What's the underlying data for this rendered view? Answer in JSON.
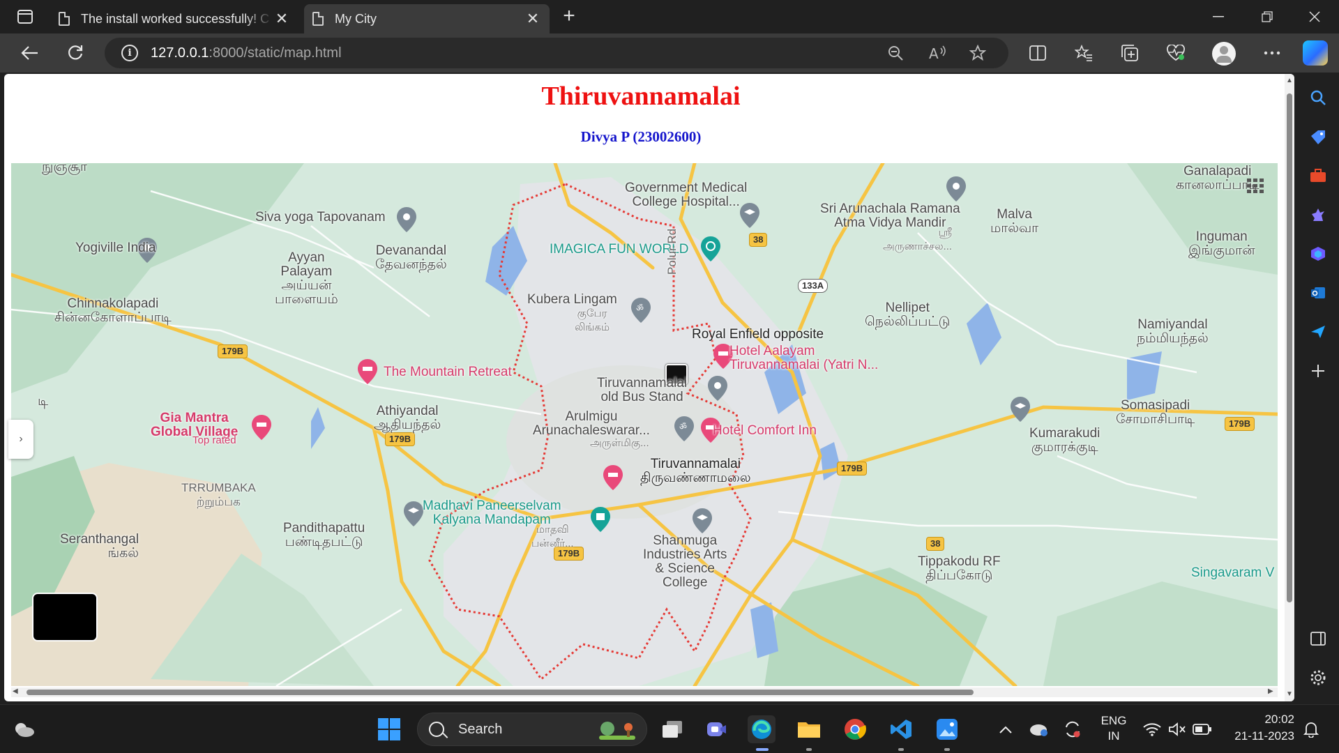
{
  "browser": {
    "tabs": [
      {
        "title": "The install worked successfully! C",
        "active": false
      },
      {
        "title": "My City",
        "active": true
      }
    ],
    "new_tab_symbol": "+",
    "close_symbol": "✕",
    "url_host": "127.0.0.1",
    "url_path": ":8000/static/map.html",
    "info_symbol": "i"
  },
  "page": {
    "title": "Thiruvannamalai",
    "subtitle": "Divya P (23002600)"
  },
  "map": {
    "labels": [
      {
        "id": "nunjur",
        "text": "நுஞ்சூர்"
      },
      {
        "id": "govt-med",
        "text": "Government Medical\nCollege Hospital..."
      },
      {
        "id": "sri-arunachala",
        "text": "Sri Arunachala Ramana\nAtma Vidya Mandir"
      },
      {
        "id": "sri-arunachala-ta",
        "text": "ஸ்ரீ\nஅருணாச்சல..."
      },
      {
        "id": "malva",
        "text": "Malva\nமால்வா"
      },
      {
        "id": "ganalapadi",
        "text": "Ganalapadi\nகானலாப்பாடி"
      },
      {
        "id": "siva-yoga",
        "text": "Siva yoga Tapovanam"
      },
      {
        "id": "yogiville",
        "text": "Yogiville India"
      },
      {
        "id": "ayyan",
        "text": "Ayyan\nPalayam\nஅய்யன்\nபாளையம்"
      },
      {
        "id": "devanandal",
        "text": "Devanandal\nதேவனந்தல்"
      },
      {
        "id": "imagica",
        "text": "IMAGICA FUN WORLD"
      },
      {
        "id": "inguman",
        "text": "Inguman\nஇங்குமான்"
      },
      {
        "id": "chinnakolapadi",
        "text": "Chinnakolapadi\nசின்னகோளாப்பாடி"
      },
      {
        "id": "kubera",
        "text": "Kubera Lingam"
      },
      {
        "id": "kubera-ta",
        "text": "குபேர\nலிங்கம்"
      },
      {
        "id": "polur",
        "text": "Polur Rd"
      },
      {
        "id": "nellipet",
        "text": "Nellipet\nநெல்லிப்பட்டு"
      },
      {
        "id": "namiyandal",
        "text": "Namiyandal\nநம்மியந்தல்"
      },
      {
        "id": "royal-enfield",
        "text": "Royal Enfield opposite"
      },
      {
        "id": "hotel-aalayam",
        "text": "Hotel Aalayam\nTiruvannamalai (Yatri N..."
      },
      {
        "id": "mountain-retreat",
        "text": "The Mountain Retreat"
      },
      {
        "id": "old-bus-stand",
        "text": "Tiruvannamalai\nold Bus Stand"
      },
      {
        "id": "somasipadi",
        "text": "Somasipadi\nசோமாசிபாடி"
      },
      {
        "id": "gia-mantra",
        "text": "Gia Mantra\nGlobal Village"
      },
      {
        "id": "top-rated",
        "text": "Top rated"
      },
      {
        "id": "athiyandal",
        "text": "Athiyandal\nஆதியந்தல்"
      },
      {
        "id": "arulmigu",
        "text": "Arulmigu\nArunachaleswarar..."
      },
      {
        "id": "arulmigu-ta",
        "text": "அருள்மிகு..."
      },
      {
        "id": "hotel-comfort",
        "text": "Hotel Comfort Inn"
      },
      {
        "id": "kumarakudi",
        "text": "Kumarakudi\nகுமாரக்குடி"
      },
      {
        "id": "tiruvannamalai",
        "text": "Tiruvannamalai\nதிருவண்ணாமலை"
      },
      {
        "id": "trrumbaka",
        "text": "TRRUMBAKA\nற்றும்பக"
      },
      {
        "id": "madhavi",
        "text": "Madhavi Paneerselvam\nKalyana Mandapam"
      },
      {
        "id": "madhavi-ta",
        "text": "மாதவி\nபன்னீர்..."
      },
      {
        "id": "pandithapattu",
        "text": "Pandithapattu\nபண்டிதபட்டு"
      },
      {
        "id": "seranthangal",
        "text": "Seranthangal\nங்கல்"
      },
      {
        "id": "shanmuga",
        "text": "Shanmuga\nIndustries Arts\n& Science\nCollege"
      },
      {
        "id": "tippakodu",
        "text": "Tippakodu RF\nதிப்பகோடு"
      },
      {
        "id": "singavaram",
        "text": "Singavaram V"
      },
      {
        "id": "edge-di",
        "text": "டி"
      }
    ],
    "shields": [
      {
        "id": "s38a",
        "text": "38"
      },
      {
        "id": "s133a",
        "text": "133A"
      },
      {
        "id": "s179b-1",
        "text": "179B"
      },
      {
        "id": "s179b-2",
        "text": "179B"
      },
      {
        "id": "s179b-3",
        "text": "179B"
      },
      {
        "id": "s179b-4",
        "text": "179B"
      },
      {
        "id": "s179b-5",
        "text": "179B"
      },
      {
        "id": "s38b",
        "text": "38"
      }
    ],
    "side_handle_symbol": "›"
  },
  "taskbar": {
    "search_label": "Search",
    "language": "ENG\nIN",
    "time": "20:02",
    "date": "21-11-2023"
  },
  "icons": {
    "back": "back-arrow-icon",
    "refresh": "refresh-icon",
    "zoom": "zoom-out-icon",
    "read_aloud": "read-aloud-icon",
    "favorite": "star-icon",
    "split": "split-screen-icon",
    "favorites": "favorites-icon",
    "collections": "collections-icon",
    "health": "browser-essentials-icon",
    "more": "more-icon"
  },
  "colors": {
    "title": "#ee1111",
    "subtitle": "#1515cc",
    "map_bg": "#d5e9dd",
    "road": "#f6c443",
    "boundary": "#e53935"
  }
}
